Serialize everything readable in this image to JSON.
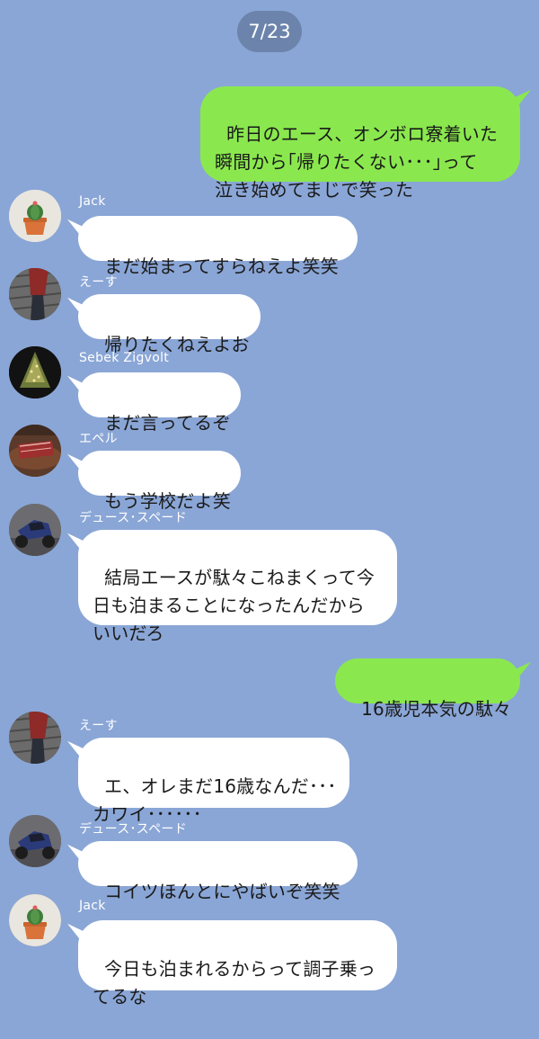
{
  "date_label": "7/23",
  "messages": [
    {
      "type": "out",
      "text": "昨日のエース、オンボロ寮着いた\n瞬間から｢帰りたくない･･･｣って\n泣き始めてまじで笑った"
    },
    {
      "type": "in",
      "sender": "Jack",
      "avatar": "cactus-avatar",
      "text": "まだ始まってすらねえよ笑笑"
    },
    {
      "type": "in",
      "sender": "えーす",
      "avatar": "red-jacket-avatar",
      "text": "帰りたくねえよお"
    },
    {
      "type": "in",
      "sender": "Sebek Zigvolt",
      "avatar": "lit-tree-avatar",
      "text": "まだ言ってるぞ"
    },
    {
      "type": "in",
      "sender": "エペル",
      "avatar": "steak-avatar",
      "text": "もう学校だよ笑"
    },
    {
      "type": "in",
      "sender": "デュース･スペード",
      "avatar": "motorcycle-avatar",
      "text": "結局エースが駄々こねまくって今\n日も泊まることになったんだから\nいいだろ"
    },
    {
      "type": "out",
      "text": "16歳児本気の駄々"
    },
    {
      "type": "in",
      "sender": "えーす",
      "avatar": "red-jacket-avatar",
      "text": "エ、オレまだ16歳なんだ･･･\nカワイ･･････"
    },
    {
      "type": "in",
      "sender": "デュース･スペード",
      "avatar": "motorcycle-avatar",
      "text": "コイツほんとにやばいぞ笑笑"
    },
    {
      "type": "in",
      "sender": "Jack",
      "avatar": "cactus-avatar",
      "text": "今日も泊まれるからって調子乗っ\nてるな"
    }
  ]
}
